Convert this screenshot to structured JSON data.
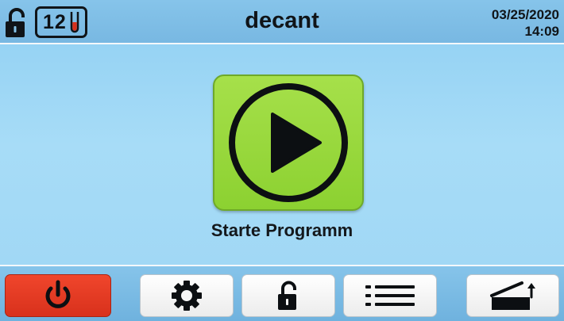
{
  "header": {
    "title": "decant",
    "capacity": "12",
    "date": "03/25/2020",
    "time": "14:09",
    "lock_icon": "unlocked-padlock-icon",
    "tube_icon": "test-tube-icon"
  },
  "main": {
    "start_label": "Starte Programm",
    "start_icon": "play-icon"
  },
  "toolbar": {
    "buttons": [
      {
        "icon": "power-icon"
      },
      {
        "icon": "gear-icon"
      },
      {
        "icon": "unlocked-padlock-icon"
      },
      {
        "icon": "list-menu-icon"
      },
      {
        "icon": "open-lid-icon"
      }
    ]
  },
  "colors": {
    "background": "#9ed6f4",
    "start_button": "#97d83a",
    "power_button": "#e53d24",
    "text": "#101418"
  }
}
